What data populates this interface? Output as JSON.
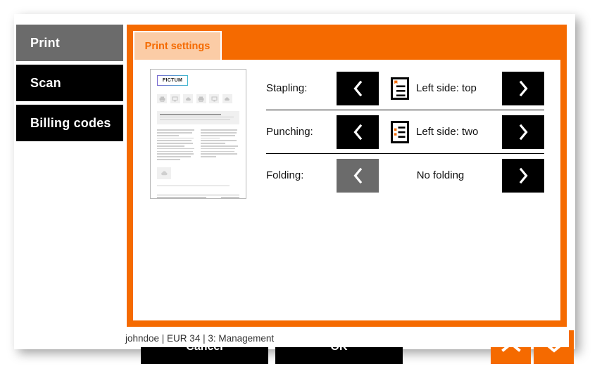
{
  "sidebar": {
    "items": [
      {
        "label": "Print",
        "state": "selected"
      },
      {
        "label": "Scan",
        "state": "normal"
      },
      {
        "label": "Billing codes",
        "state": "normal"
      }
    ]
  },
  "tabs": [
    {
      "label": "Print settings",
      "active": true
    }
  ],
  "preview": {
    "logo_text": "FICTUM",
    "icon_names": [
      "printer-icon",
      "monitor-icon",
      "cloud-icon",
      "printer-icon",
      "monitor-icon",
      "cloud-icon"
    ],
    "block_icon_name": "cloud-icon"
  },
  "settings": {
    "rows": [
      {
        "label": "Stapling:",
        "value": "Left side: top",
        "icon": "stapling-top-left-icon",
        "has_icon": true,
        "prev_enabled": true,
        "next_enabled": true,
        "prev_glyph": "‹",
        "next_glyph": "›"
      },
      {
        "label": "Punching:",
        "value": "Left side: two",
        "icon": "punching-two-left-icon",
        "has_icon": true,
        "prev_enabled": true,
        "next_enabled": true,
        "prev_glyph": "‹",
        "next_glyph": "›"
      },
      {
        "label": "Folding:",
        "value": "No folding",
        "icon": "",
        "has_icon": false,
        "prev_enabled": false,
        "next_enabled": true,
        "prev_glyph": "‹",
        "next_glyph": "›"
      }
    ]
  },
  "actions": {
    "cancel_label": "Cancel",
    "ok_label": "OK",
    "scroll_up_icon": "chevron-up-icon",
    "scroll_down_icon": "chevron-down-icon"
  },
  "status": {
    "text": "johndoe | EUR 34 | 3: Management"
  },
  "colors": {
    "accent": "#f56a00",
    "tab_active_bg": "#fbcca6",
    "selected_sidebar": "#6b6b6b",
    "button_bg": "#000000",
    "disabled_bg": "#6b6b6b"
  }
}
